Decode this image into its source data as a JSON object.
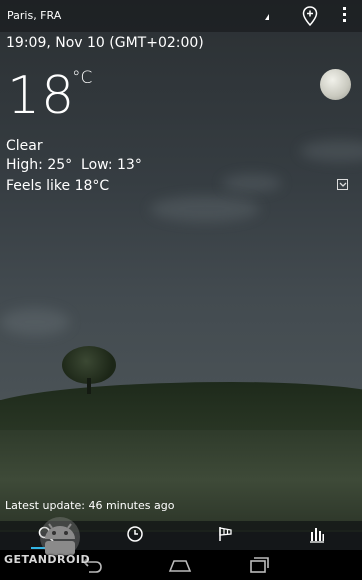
{
  "location": "Paris, FRA",
  "datetime": "19:09, Nov 10 (GMT+02:00)",
  "weather": {
    "temperature": "18",
    "unit": "°C",
    "condition": "Clear",
    "high_low": "High: 25°  Low: 13°",
    "feels_like": "Feels like 18°C"
  },
  "updated": "Latest update: 46 minutes ago",
  "tabs": [
    {
      "icon": "search-icon",
      "active": true
    },
    {
      "icon": "clock-icon",
      "active": false
    },
    {
      "icon": "wind-icon",
      "active": false
    },
    {
      "icon": "chart-icon",
      "active": false
    }
  ],
  "navigation": [
    "back-icon",
    "home-icon",
    "recent-apps-icon"
  ],
  "watermark": "GETANDROID",
  "colors": {
    "accent": "#33b5e5",
    "tab_bar": "#121416",
    "nav_bar": "#000000"
  }
}
